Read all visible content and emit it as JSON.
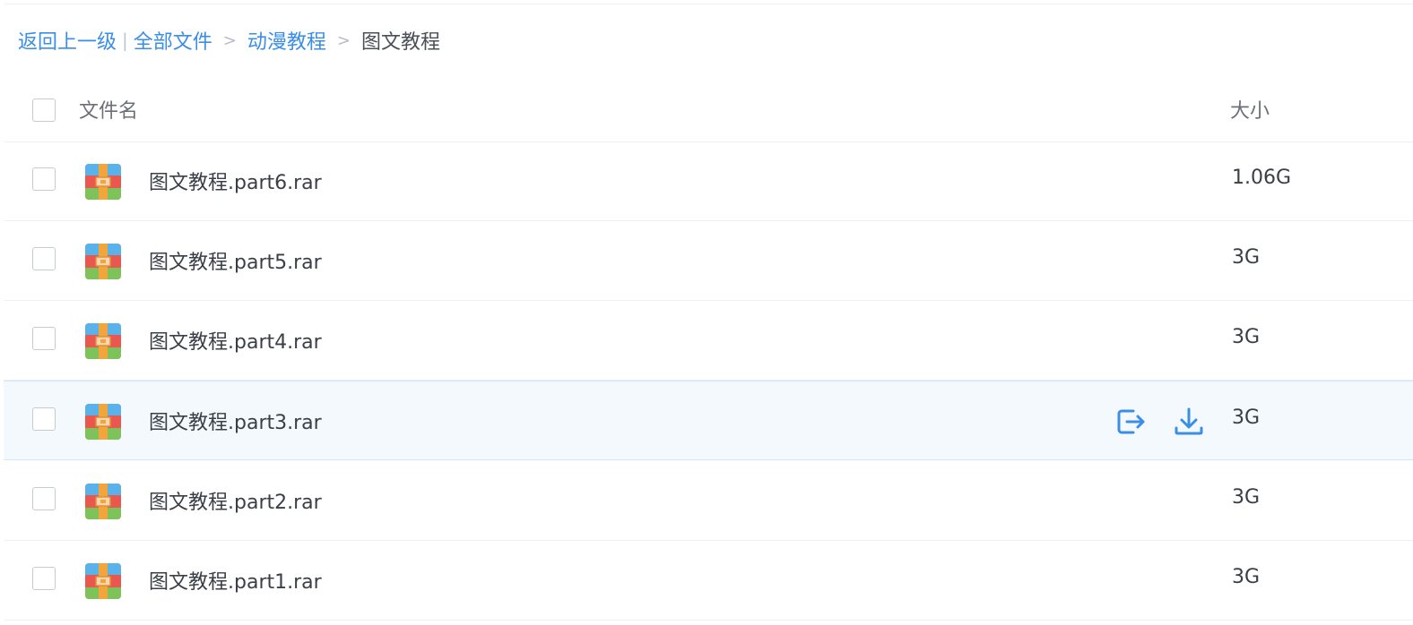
{
  "breadcrumb": {
    "back": "返回上一级",
    "divider": "|",
    "separator": ">",
    "items": [
      "全部文件",
      "动漫教程"
    ],
    "current": "图文教程"
  },
  "table": {
    "headers": {
      "name": "文件名",
      "size": "大小"
    },
    "rows": [
      {
        "name": "图文教程.part6.rar",
        "size": "1.06G",
        "icon": "rar-archive-icon"
      },
      {
        "name": "图文教程.part5.rar",
        "size": "3G",
        "icon": "rar-archive-icon"
      },
      {
        "name": "图文教程.part4.rar",
        "size": "3G",
        "icon": "rar-archive-icon"
      },
      {
        "name": "图文教程.part3.rar",
        "size": "3G",
        "icon": "rar-archive-icon",
        "hovered": true
      },
      {
        "name": "图文教程.part2.rar",
        "size": "3G",
        "icon": "rar-archive-icon"
      },
      {
        "name": "图文教程.part1.rar",
        "size": "3G",
        "icon": "rar-archive-icon"
      }
    ]
  },
  "row_actions": {
    "share_icon": "share-out-icon",
    "download_icon": "download-icon"
  },
  "colors": {
    "link": "#3a8ee6",
    "hover_row_bg": "#f4f9fe",
    "action_icon": "#3a8ee6"
  }
}
